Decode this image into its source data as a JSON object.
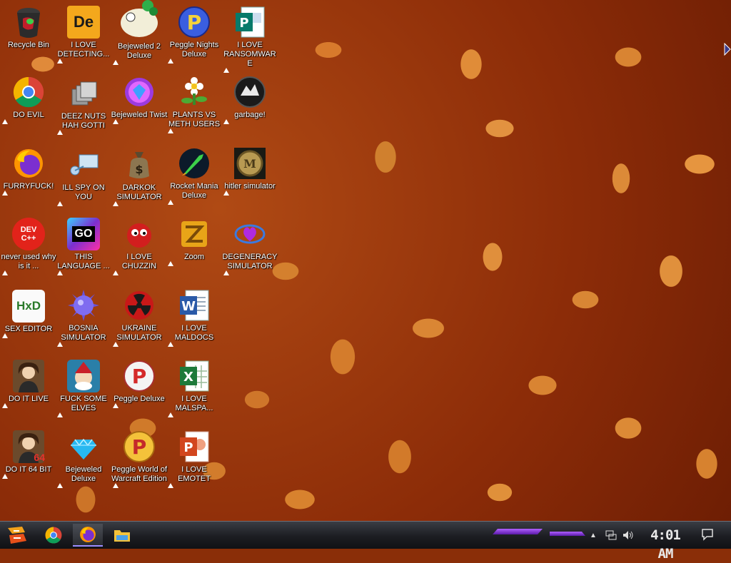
{
  "desktop": {
    "icons": [
      {
        "label": "Recycle Bin"
      },
      {
        "label": "I LOVE DETECTING..."
      },
      {
        "label": "Bejeweled 2 Deluxe"
      },
      {
        "label": "Peggle Nights Deluxe"
      },
      {
        "label": "I LOVE RANSOMWARE"
      },
      {
        "label": "DO EVIL"
      },
      {
        "label": "DEEZ NUTS HAH GOTTI"
      },
      {
        "label": "Bejeweled Twist"
      },
      {
        "label": "PLANTS VS METH USERS"
      },
      {
        "label": "garbage!"
      },
      {
        "label": "FURRYFUCK!"
      },
      {
        "label": "ILL SPY ON YOU"
      },
      {
        "label": "DARKOK SIMULATOR"
      },
      {
        "label": "Rocket Mania Deluxe"
      },
      {
        "label": "hitler simulator"
      },
      {
        "label": "never used why is it ..."
      },
      {
        "label": "THIS LANGUAGE ..."
      },
      {
        "label": "I LOVE CHUZZIN"
      },
      {
        "label": "Zoom"
      },
      {
        "label": "DEGENERACY SIMULATOR"
      },
      {
        "label": "SEX EDITOR"
      },
      {
        "label": "BOSNIA SIMULATOR"
      },
      {
        "label": "UKRAINE SIMULATOR"
      },
      {
        "label": "I LOVE MALDOCS"
      },
      {
        "label": "DO IT LIVE"
      },
      {
        "label": "FUCK SOME ELVES"
      },
      {
        "label": "Peggle Deluxe"
      },
      {
        "label": "I LOVE MALSPA..."
      },
      {
        "label": "DO IT 64 BIT"
      },
      {
        "label": "Bejeweled Deluxe"
      },
      {
        "label": "Peggle World of Warcraft Edition"
      },
      {
        "label": "I LOVE EMOTET"
      }
    ],
    "icon_glyphs": {
      "dev_cpp": "DEV C++",
      "go": "GO",
      "hex": "HxD",
      "ie": "De",
      "sixtyfour": "64"
    }
  },
  "taskbar": {
    "clock": "4:01 AM",
    "start_icon": "start-icon",
    "pinned": [
      "chrome-icon",
      "firefox-icon",
      "file-explorer-icon"
    ]
  },
  "colors": {
    "taskbar": "#1c1d22",
    "accent": "#9a8cff",
    "purple": "#7b2fd0"
  }
}
